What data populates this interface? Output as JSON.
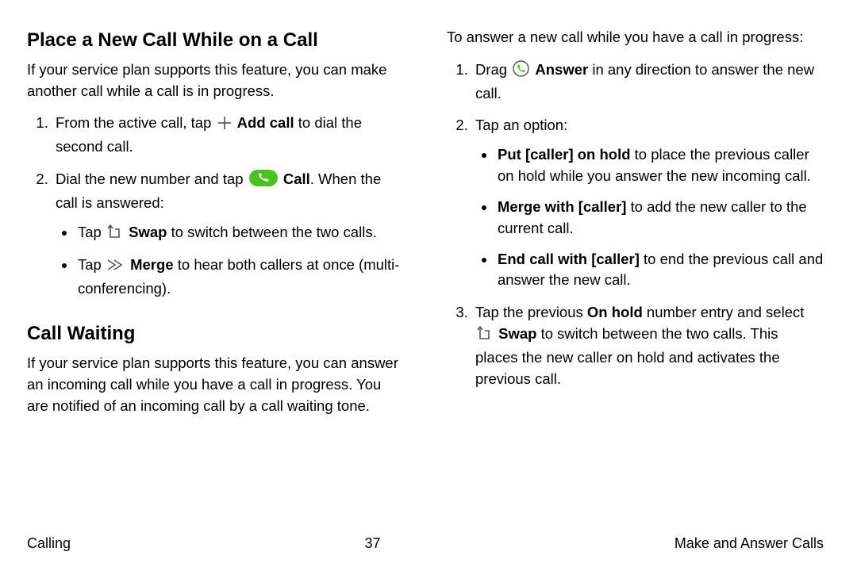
{
  "left": {
    "h1": "Place a New Call While on a Call",
    "intro": "If your service plan supports this feature, you can make another call while a call is in progress.",
    "step1_a": "From the active call, tap ",
    "step1_bold": "Add call",
    "step1_b": " to dial the second call.",
    "step2_a": "Dial the new number and tap ",
    "step2_bold": "Call",
    "step2_b": ". When the call is answered:",
    "sub1_a": "Tap ",
    "sub1_bold": "Swap",
    "sub1_b": " to switch between the two calls.",
    "sub2_a": "Tap ",
    "sub2_bold": "Merge",
    "sub2_b": " to hear both callers at once (multi-conferencing).",
    "h2": "Call Waiting",
    "p2": "If your service plan supports this feature, you can answer an incoming call while you have a call in progress. You are notified of an incoming call by a call waiting tone."
  },
  "right": {
    "intro": "To answer a new call while you have a call in progress:",
    "s1_a": "Drag ",
    "s1_bold": "Answer",
    "s1_b": " in any direction to answer the new call.",
    "s2": "Tap an option:",
    "b1_bold": "Put [caller] on hold",
    "b1_b": " to place the previous caller on hold while you answer the new incoming call.",
    "b2_bold": "Merge with [caller]",
    "b2_b": " to add the new caller to the current call.",
    "b3_bold": "End call with [caller]",
    "b3_b": " to end the previous call and answer the new call.",
    "s3_a": "Tap the previous ",
    "s3_bold1": "On hold",
    "s3_b": " number entry and select ",
    "s3_bold2": "Swap",
    "s3_c": " to switch between the two calls. This places the new caller on hold and activates the previous call."
  },
  "footer": {
    "left": "Calling",
    "center": "37",
    "right": "Make and Answer Calls"
  }
}
